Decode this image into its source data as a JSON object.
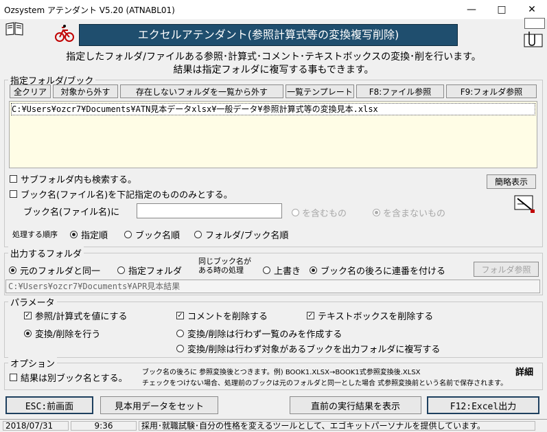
{
  "window": {
    "title": "Ozsystem アテンダント V5.20 (ATNABL01)",
    "minimize": "—",
    "maximize": "□",
    "close": "✕"
  },
  "banner": "エクセルアテンダント(参照計算式等の変換複写削除)",
  "intro": {
    "line1": "指定したフォルダ/ファイルある参照･計算式･コメント･テキストボックスの変換･削を行います。",
    "line2": "結果は指定フォルダに複写する事もできます。"
  },
  "folder_group": {
    "label": "指定フォルダ/ブック",
    "buttons": {
      "clear": "全クリア",
      "exclude": "対象から外す",
      "remove_missing": "存在しないフォルダを一覧から外す",
      "template": "一覧テンプレート",
      "f8": "F8:ファイル参照",
      "f9": "F9:フォルダ参照"
    },
    "list_items": [
      "C:¥Users¥ozcr7¥Documents¥ATN見本データxlsx¥一般データ¥参照計算式等の変換見本.xlsx"
    ],
    "subfolder_label": "サブフォルダ内も検索する。",
    "bookname_filter_label": "ブック名(ファイル名)を下記指定のもののみとする。",
    "bookname_input_label": "ブック名(ファイル名)に",
    "bookname_value": "",
    "contains_label": "を含むもの",
    "not_contains_label": "を含まないもの",
    "simple_button": "簡略表示",
    "order_label": "処理する順序",
    "order_options": [
      "指定順",
      "ブック名順",
      "フォルダ/ブック名順"
    ]
  },
  "output_group": {
    "label": "出力するフォルダ",
    "same_folder": "元のフォルダと同一",
    "specified_folder": "指定フォルダ",
    "same_name_line1": "同じブック名が",
    "same_name_line2": "ある時の処理",
    "overwrite": "上書き",
    "append_number": "ブック名の後ろに連番を付ける",
    "folder_ref_button": "フォルダ参照",
    "path": "C:¥Users¥ozcr7¥Documents¥APR見本結果"
  },
  "params_group": {
    "label": "パラメータ",
    "ref_to_value": "参照/計算式を値にする",
    "delete_comment": "コメントを削除する",
    "delete_textbox": "テキストボックスを削除する",
    "do_convert": "変換/削除を行う",
    "list_only": "変換/削除は行わず一覧のみを作成する",
    "copy_only": "変換/削除は行わず対象があるブックを出力フォルダに複写する"
  },
  "options_group": {
    "label": "オプション",
    "separate_name": "結果は別ブック名とする。",
    "note1": "ブック名の後ろに 参照変換後とつきます。例) BOOK1.XLSX→BOOK1式参照変換後.XLSX",
    "note2": "チェックをつけない場合、処理前のブックは元のフォルダと同一とした場合 式参照変換前という名前で保存されます。",
    "detail": "詳細"
  },
  "bottom_buttons": {
    "esc": "ESC:前画面",
    "sample": "見本用データをセット",
    "last_result": "直前の実行結果を表示",
    "f12": "F12:Excel出力"
  },
  "status": {
    "date": "2018/07/31",
    "time": "9:36",
    "message": "採用･就職試験･自分の性格を変えるツールとして、エゴキットパーソナルを提供しています。"
  },
  "colors": {
    "banner_bg": "#1f4e6e",
    "list_bg": "#fffde6",
    "selected_row": "#ffffff"
  }
}
